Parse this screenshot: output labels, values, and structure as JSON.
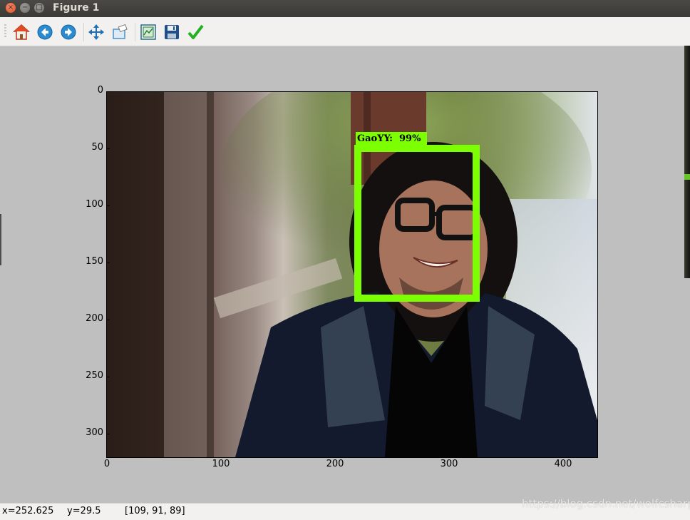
{
  "window": {
    "title": "Figure 1"
  },
  "toolbar": {
    "buttons": [
      {
        "name": "home",
        "icon": "home-icon",
        "color": "#e04b25"
      },
      {
        "name": "back",
        "icon": "arrow-left-icon",
        "color": "#1f7fc0"
      },
      {
        "name": "forward",
        "icon": "arrow-right-icon",
        "color": "#1f7fc0"
      },
      {
        "name": "pan",
        "icon": "move-icon",
        "color": "#1f6fb4"
      },
      {
        "name": "zoom",
        "icon": "zoom-rect-icon",
        "color": "#4a90c7"
      },
      {
        "name": "subplots",
        "icon": "subplots-icon",
        "color": "#2a7d3a"
      },
      {
        "name": "save",
        "icon": "save-icon",
        "color": "#1d4f8a"
      },
      {
        "name": "edit",
        "icon": "checkmark-icon",
        "color": "#23b023"
      }
    ]
  },
  "axes": {
    "y_ticks": [
      "0",
      "50",
      "100",
      "150",
      "200",
      "250",
      "300"
    ],
    "x_ticks": [
      "0",
      "100",
      "200",
      "300",
      "400"
    ],
    "detection": {
      "label": "GaoYY:  99%",
      "box_color": "#7cff00"
    }
  },
  "status": {
    "x": "x=252.625",
    "y": "y=29.5",
    "pixel": "[109, 91, 89]"
  },
  "watermark": "https://blog.csdn.net/wolfcsharp"
}
